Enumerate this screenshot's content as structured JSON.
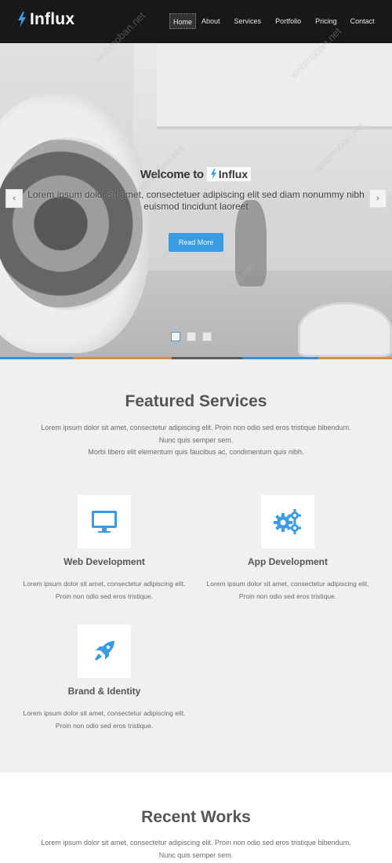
{
  "header": {
    "brand": "Influx",
    "nav": [
      "Home",
      "About",
      "Services",
      "Portfolio",
      "Pricing",
      "Contact"
    ],
    "active_index": 0
  },
  "hero": {
    "welcome_prefix": "Welcome to",
    "welcome_brand": "Influx",
    "tagline": "Lorem ipsum dolor sit amet, consectetuer adipiscing elit sed diam nonummy nibh euismod tincidunt laoreet",
    "button": "Read More",
    "prev_icon": "chevron-left-icon",
    "next_icon": "chevron-right-icon",
    "slides": 3,
    "active_slide": 1
  },
  "colors": {
    "accent": "#3b9ce3",
    "header_bg": "#181818",
    "stripe": [
      "#3b8ed6",
      "#d98c4c",
      "#5b5b5b",
      "#3b8ed6",
      "#d98c4c"
    ]
  },
  "services": {
    "title": "Featured Services",
    "desc_line1": "Lorem ipsum dolor sit amet, consectetur adipiscing elit. Proin non odio sed eros tristique bibendum.",
    "desc_line2": "Nunc quis semper sem.",
    "desc_line3": "Morbi libero elit elementum quis faucibus ac, condimentum quis nibh.",
    "items": [
      {
        "title": "Web Development",
        "icon": "monitor-icon",
        "text1": "Lorem ipsum dolor sit amet, consectetur adipiscing elit.",
        "text2": "Proin non odio sed eros tristique."
      },
      {
        "title": "App Development",
        "icon": "gears-icon",
        "text1": "Lorem ipsum dolor sit amet, consectetur adipiscing elit.",
        "text2": "Proin non odio sed eros tristique."
      },
      {
        "title": "Brand & Identity",
        "icon": "rocket-icon",
        "text1": "Lorem ipsum dolor sit amet, consectetur adipiscing elit.",
        "text2": "Proin non odio sed eros tristique."
      }
    ]
  },
  "works": {
    "title": "Recent Works",
    "desc_line1": "Lorem ipsum dolor sit amet, consectetur adipiscing elit. Proin non odio sed eros tristique bibendum.",
    "desc_line2": "Nunc quis semper sem."
  },
  "watermark": "webmoban.net"
}
